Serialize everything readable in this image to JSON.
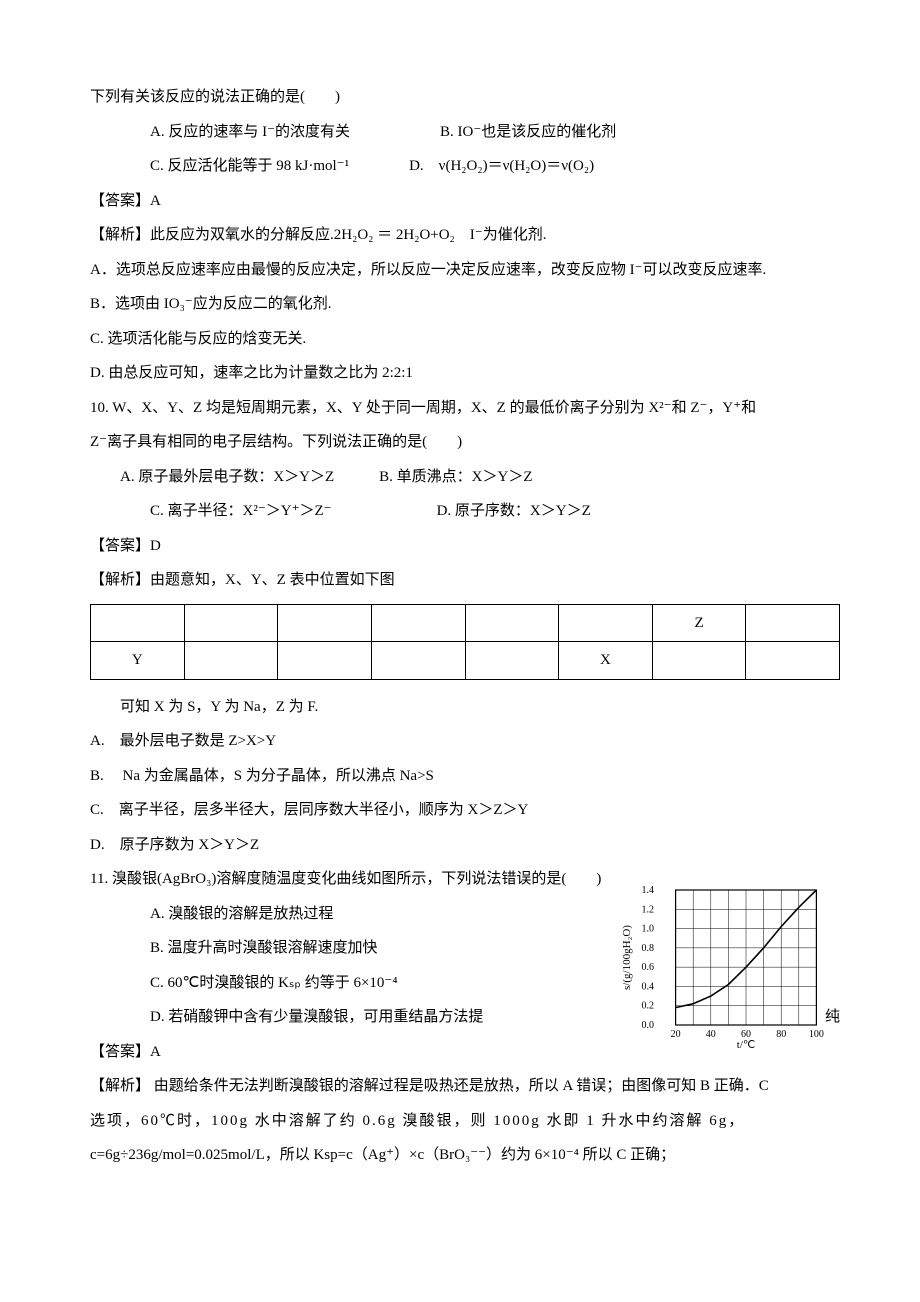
{
  "q9": {
    "stem": "下列有关该反应的说法正确的是(　　)",
    "optA": "A.  反应的速率与 I⁻的浓度有关",
    "optB": "B.  IO⁻也是该反应的催化剂",
    "optC": "C.  反应活化能等于 98  kJ·mol⁻¹",
    "optD": "D.　ν(H₂O₂)＝ν(H₂O)＝ν(O₂)",
    "ans": "【答案】A",
    "exp": "【解析】此反应为双氧水的分解反应.2H₂O₂ ＝ 2H₂O+O₂　I⁻为催化剂.",
    "eA": "A．选项总反应速率应由最慢的反应决定，所以反应一决定反应速率，改变反应物 I⁻可以改变反应速率.",
    "eB": "B．选项由 IO₃⁻应为反应二的氧化剂.",
    "eC": "C.  选项活化能与反应的焓变无关.",
    "eD": "D.  由总反应可知，速率之比为计量数之比为 2:2:1"
  },
  "q10": {
    "stem1": "10.  W、X、Y、Z 均是短周期元素，X、Y 处于同一周期，X、Z 的最低价离子分别为 X²⁻和 Z⁻，Y⁺和",
    "stem2": "Z⁻离子具有相同的电子层结构。下列说法正确的是(　　)",
    "optA": "A.  原子最外层电子数：X＞Y＞Z",
    "optB": "B.  单质沸点：X＞Y＞Z",
    "optC": "C.  离子半径：X²⁻＞Y⁺＞Z⁻",
    "optD": "D.  原子序数：X＞Y＞Z",
    "ans": "【答案】D",
    "exp": "【解析】由题意知，X、Y、Z 表中位置如下图",
    "table": {
      "r0c6": "Z",
      "r1c0": "Y",
      "r1c5": "X"
    },
    "l1": "可知 X 为 S，Y 为 Na，Z 为 F.",
    "l2": "A.　最外层电子数是 Z>X>Y",
    "l3": "B.　 Na 为金属晶体，S 为分子晶体，所以沸点 Na>S",
    "l4": "C.　离子半径，层多半径大，层同序数大半径小，顺序为 X＞Z＞Y",
    "l5": "D.　原子序数为 X＞Y＞Z"
  },
  "q11": {
    "stem": "11.  溴酸银(AgBrO₃)溶解度随温度变化曲线如图所示，下列说法错误的是(　　)",
    "optA": "A.  溴酸银的溶解是放热过程",
    "optB": "B.  温度升高时溴酸银溶解速度加快",
    "optC": "C.  60℃时溴酸银的 Kₛₚ 约等于 6×10⁻⁴",
    "optD_a": "D.  若硝酸钾中含有少量溴酸银，可用重结晶方法提",
    "optD_b": "纯",
    "ans": "【答案】A",
    "exp1": "【解析】 由题给条件无法判断溴酸银的溶解过程是吸热还是放热，所以 A 错误；由图像可知 B 正确．C",
    "exp2": "选项，60℃时，100g 水中溶解了约 0.6g 溴酸银，则 1000g 水即 1 升水中约溶解 6g，",
    "exp3": "c=6g÷236g/mol=0.025mol/L，所以 Ksp=c（Ag⁺）×c（BrO₃⁻⁻）约为 6×10⁻⁴ 所以 C 正确；"
  },
  "chart_data": {
    "type": "line",
    "x": [
      20,
      30,
      40,
      50,
      60,
      70,
      80,
      90,
      100
    ],
    "values": [
      0.18,
      0.22,
      0.3,
      0.42,
      0.6,
      0.8,
      1.02,
      1.22,
      1.4
    ],
    "xlabel": "t/℃",
    "ylabel": "s/(g/100gH₂O)",
    "xlim": [
      10,
      110
    ],
    "ylim": [
      0.0,
      1.4
    ],
    "xticks": [
      20,
      40,
      60,
      80,
      100
    ],
    "yticks": [
      0.0,
      0.2,
      0.4,
      0.6,
      0.8,
      1.0,
      1.2,
      1.4
    ]
  }
}
